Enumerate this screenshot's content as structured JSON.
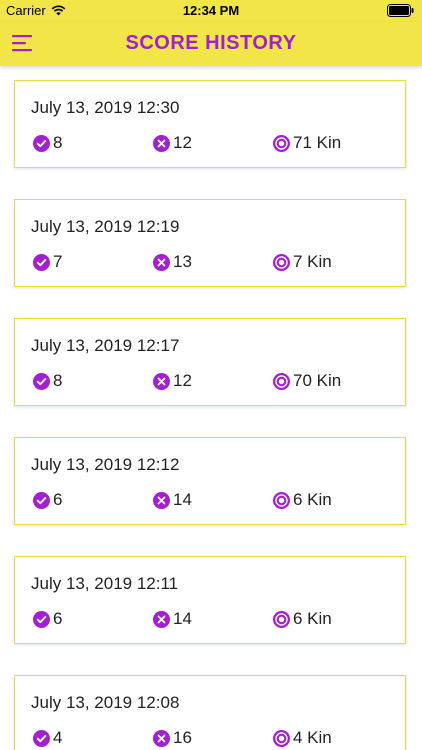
{
  "status_bar": {
    "carrier": "Carrier",
    "time": "12:34 PM"
  },
  "nav": {
    "title": "SCORE HISTORY"
  },
  "colors": {
    "accent": "#A51FD2",
    "bar": "#F2E54A",
    "border": "#E6DC3E"
  },
  "icons": {
    "menu": "menu-icon",
    "correct": "check-circle-icon",
    "wrong": "x-circle-icon",
    "kin": "kin-coin-icon"
  },
  "records": [
    {
      "date": "July 13, 2019  12:30",
      "correct": "8",
      "wrong": "12",
      "kin": "71 Kin"
    },
    {
      "date": "July 13, 2019  12:19",
      "correct": "7",
      "wrong": "13",
      "kin": "7 Kin"
    },
    {
      "date": "July 13, 2019  12:17",
      "correct": "8",
      "wrong": "12",
      "kin": "70 Kin"
    },
    {
      "date": "July 13, 2019  12:12",
      "correct": "6",
      "wrong": "14",
      "kin": "6 Kin"
    },
    {
      "date": "July 13, 2019  12:11",
      "correct": "6",
      "wrong": "14",
      "kin": "6 Kin"
    },
    {
      "date": "July 13, 2019  12:08",
      "correct": "4",
      "wrong": "16",
      "kin": "4 Kin"
    }
  ]
}
